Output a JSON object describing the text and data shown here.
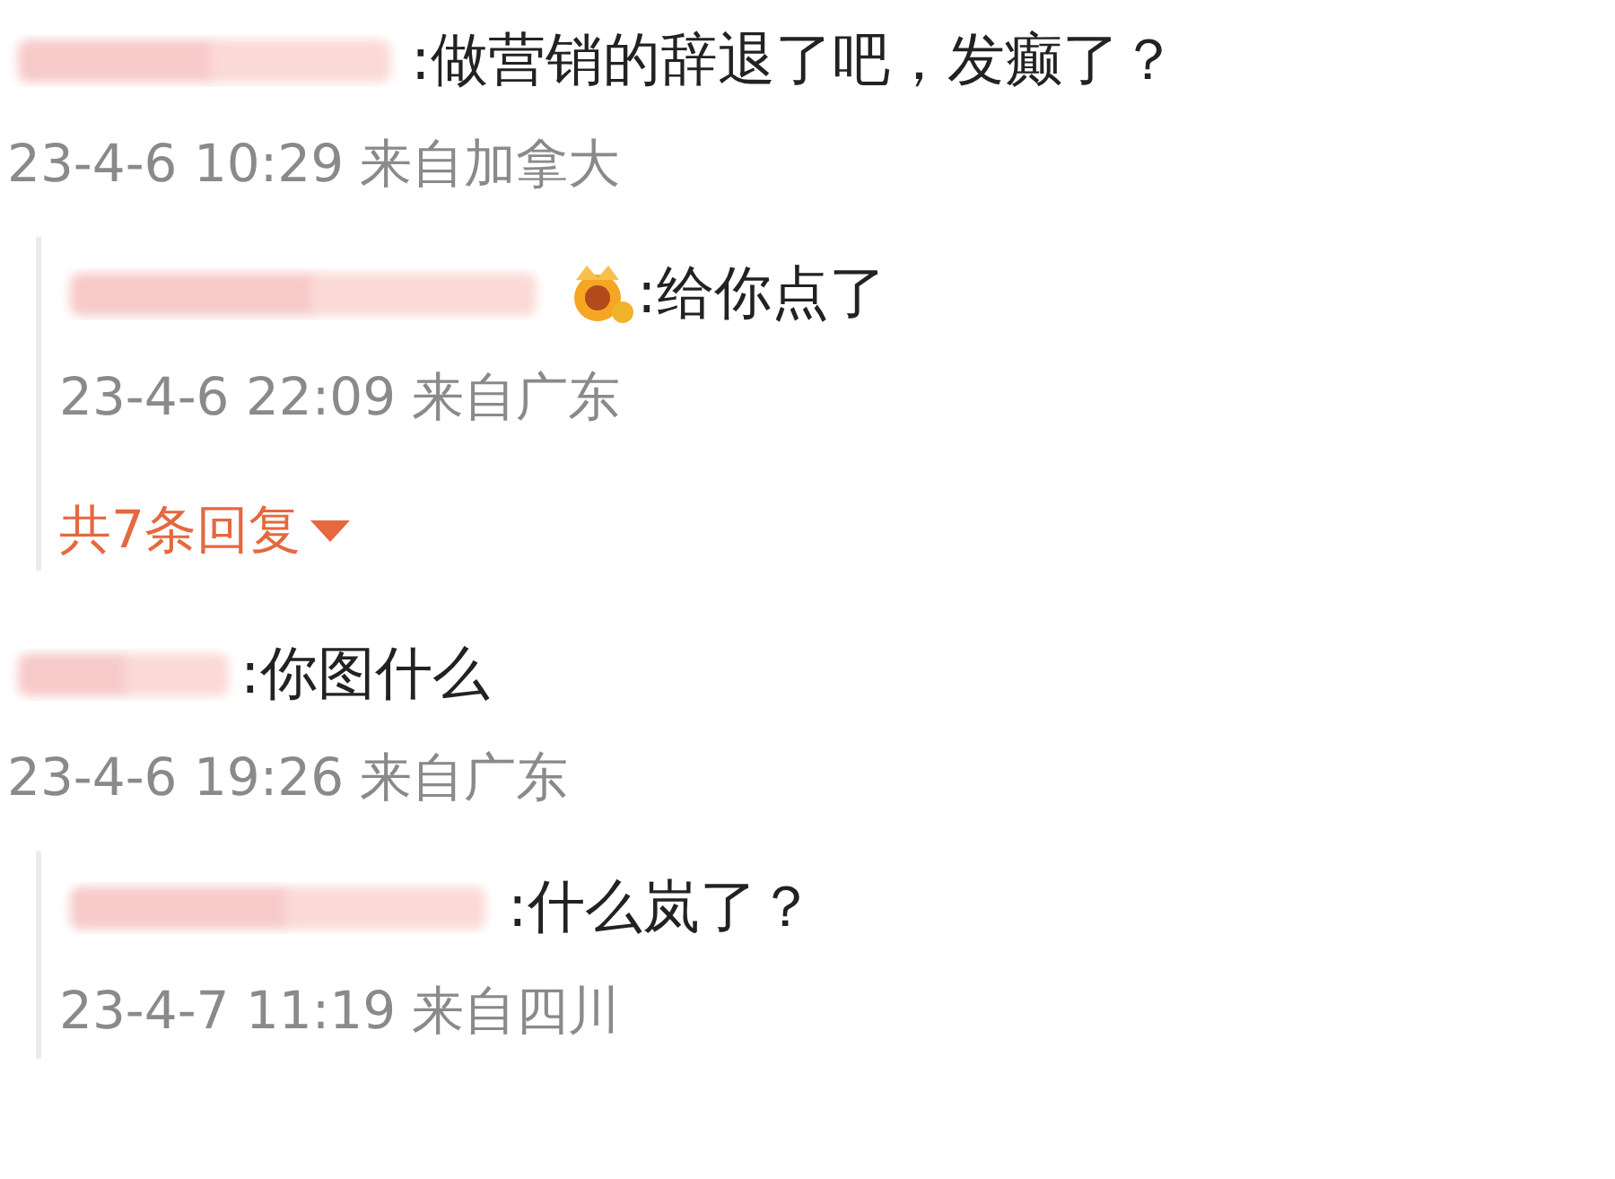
{
  "comments": [
    {
      "text": ":做营销的辞退了吧，发癫了？",
      "time": "23-4-6 10:29 来自加拿大",
      "replies": [
        {
          "text": ":给你点了",
          "time": "23-4-6 22:09 来自广东",
          "badge": true
        }
      ],
      "more_replies": "共7条回复"
    },
    {
      "text": ":你图什么",
      "time": "23-4-6 19:26 来自广东",
      "replies": [
        {
          "text": ":什么岚了？",
          "time": "23-4-7 11:19 来自四川",
          "badge": false
        }
      ]
    }
  ]
}
